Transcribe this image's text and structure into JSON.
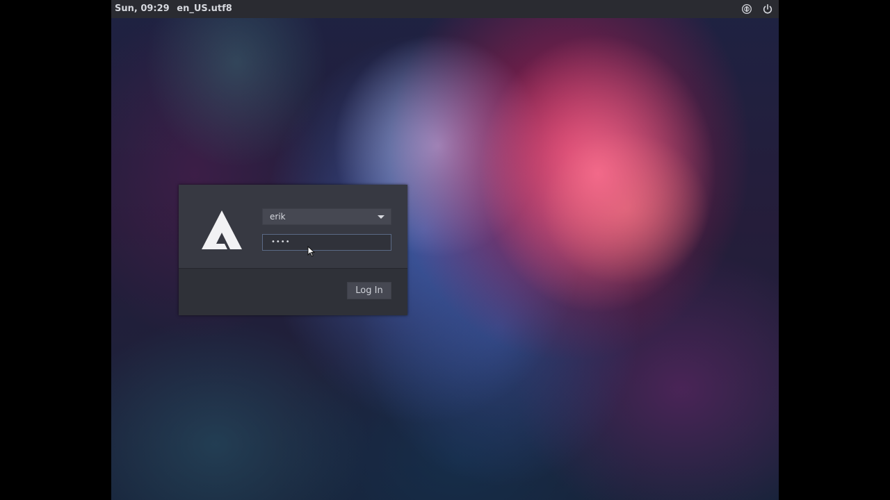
{
  "topbar": {
    "clock": "Sun, 09:29",
    "locale": "en_US.utf8",
    "accessibility_icon": "accessibility-icon",
    "power_icon": "power-icon"
  },
  "login": {
    "logo_icon": "arcolinux-logo",
    "username": "erik",
    "password_masked": "••••",
    "login_label": "Log In"
  },
  "colors": {
    "topbar_bg": "#2a2b31",
    "panel_bg": "#2f3138",
    "panel_top_bg": "#373942",
    "input_focus_border": "#5b6a86"
  }
}
